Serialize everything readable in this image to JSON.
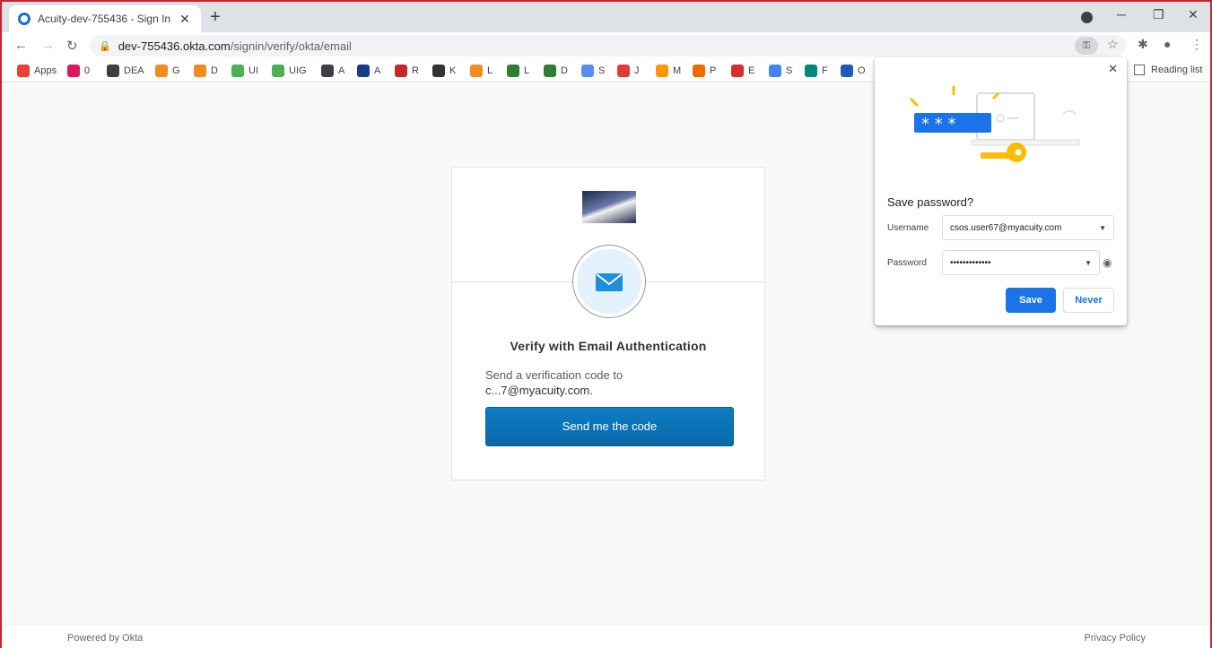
{
  "browser": {
    "tab_title": "Acuity-dev-755436 - Sign In",
    "tab_close": "✕",
    "new_tab": "+",
    "url_host": "dev-755436.okta.com",
    "url_path": "/signin/verify/okta/email",
    "reading_list": "Reading list",
    "bookmarks": [
      {
        "label": "Apps",
        "color": "#e94235"
      },
      {
        "label": "0",
        "color": "#d81b60"
      },
      {
        "label": "DEA",
        "color": "#3c4043"
      },
      {
        "label": "G",
        "color": "#f28b22"
      },
      {
        "label": "D",
        "color": "#f28b22"
      },
      {
        "label": "UI",
        "color": "#4caf50"
      },
      {
        "label": "UIG",
        "color": "#4caf50"
      },
      {
        "label": "A",
        "color": "#3c4043"
      },
      {
        "label": "A",
        "color": "#1a3b8a"
      },
      {
        "label": "R",
        "color": "#c62828"
      },
      {
        "label": "K",
        "color": "#333333"
      },
      {
        "label": "L",
        "color": "#f28b22"
      },
      {
        "label": "L",
        "color": "#2e7d32"
      },
      {
        "label": "D",
        "color": "#2e7d32"
      },
      {
        "label": "S",
        "color": "#5b8def"
      },
      {
        "label": "J",
        "color": "#e53935"
      },
      {
        "label": "M",
        "color": "#ff9800"
      },
      {
        "label": "P",
        "color": "#ef6c00"
      },
      {
        "label": "E",
        "color": "#d32f2f"
      },
      {
        "label": "S",
        "color": "#4285f4"
      },
      {
        "label": "F",
        "color": "#00897b"
      },
      {
        "label": "O",
        "color": "#1e5bb8"
      }
    ]
  },
  "okta": {
    "title": "Verify with Email Authentication",
    "desc": "Send a verification code to",
    "email": "c...7@myacuity.com.",
    "button": "Send me the code",
    "footer_left": "Powered by Okta",
    "footer_right": "Privacy Policy"
  },
  "save_password": {
    "heading": "Save password?",
    "username_label": "Username",
    "username_value": "csos.user67@myacuity.com",
    "password_label": "Password",
    "password_value": "•••••••••••••",
    "save": "Save",
    "never": "Never",
    "close": "✕"
  },
  "colors": {
    "accent": "#1a73e8",
    "okta_button": "#0d7cc4",
    "frame": "#d0202a"
  }
}
